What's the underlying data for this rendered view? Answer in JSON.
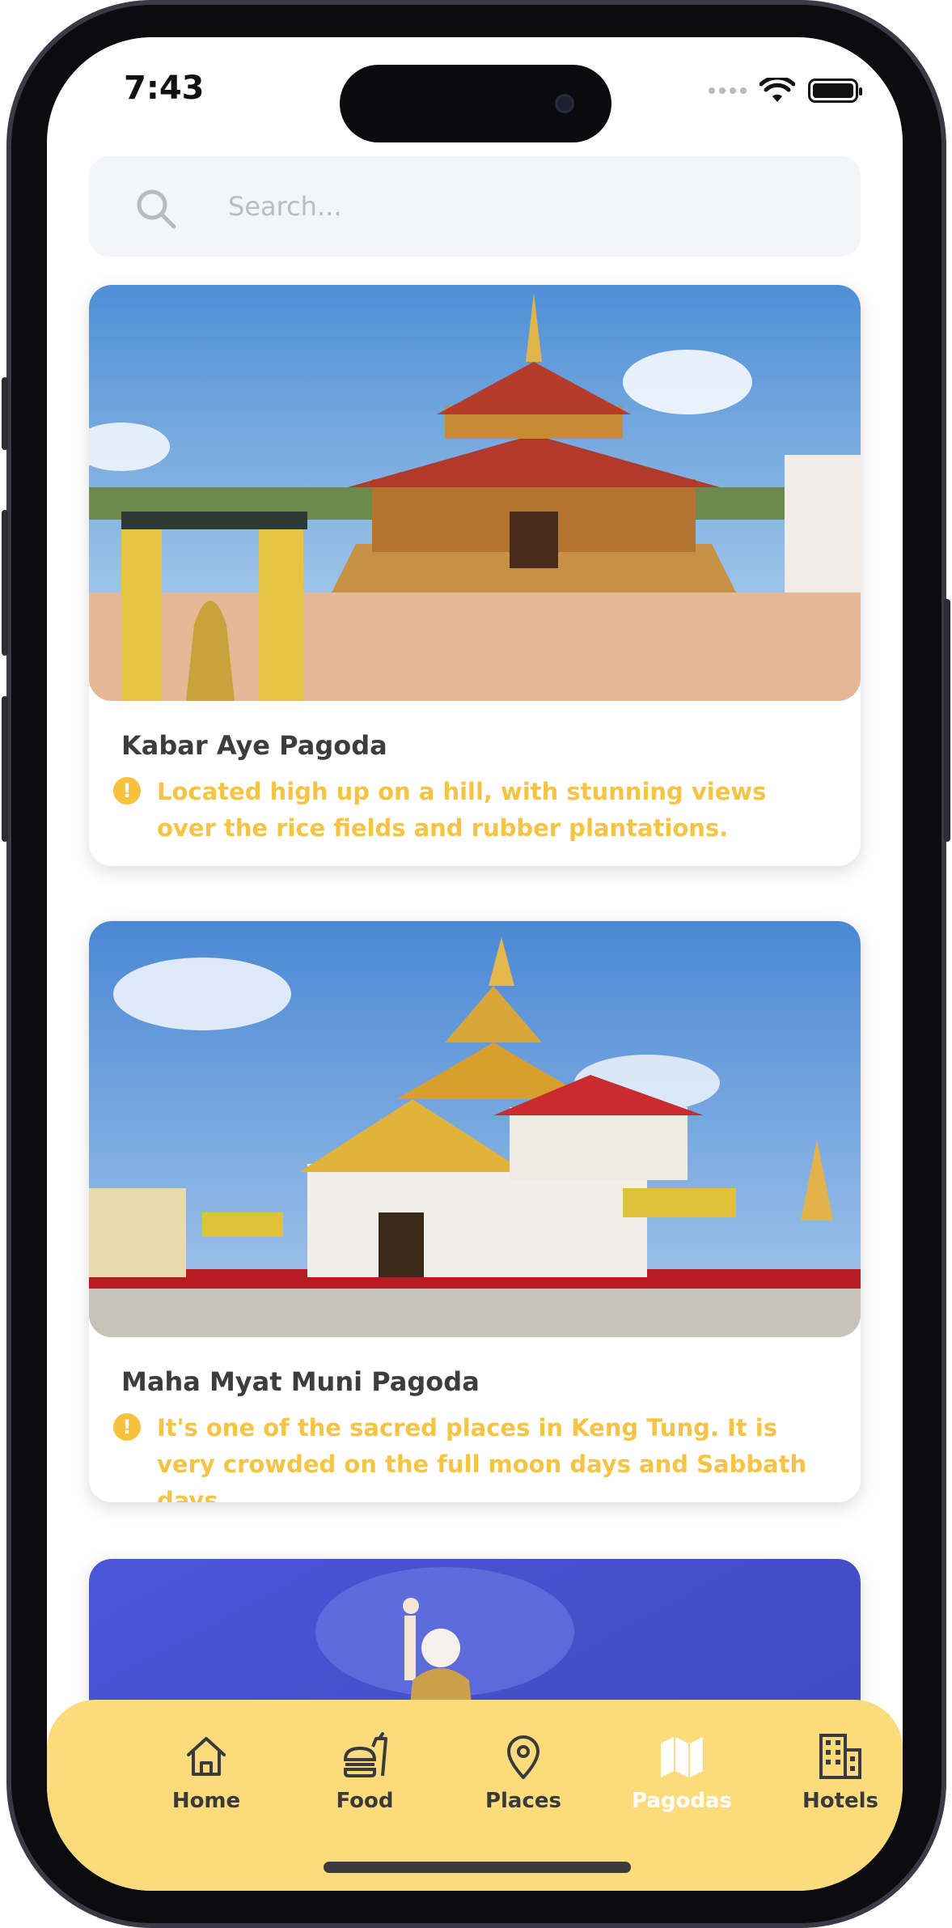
{
  "status": {
    "time": "7:43"
  },
  "search": {
    "placeholder": "Search..."
  },
  "cards": [
    {
      "title": "Kabar Aye Pagoda",
      "description": "Located high up on a hill, with stunning views over the rice fields and rubber plantations.",
      "image": "golden-red-pagoda-photo"
    },
    {
      "title": "Maha Myat Muni Pagoda",
      "description": "It's one of the sacred places in Keng Tung. It is very crowded on the full moon days and Sabbath days.",
      "image": "white-gold-temple-photo"
    },
    {
      "title": "",
      "description": "",
      "image": "standing-buddha-statue-photo"
    }
  ],
  "tabs": [
    {
      "label": "Home",
      "icon": "home-icon",
      "active": false
    },
    {
      "label": "Food",
      "icon": "burger-icon",
      "active": false
    },
    {
      "label": "Places",
      "icon": "map-pin-icon",
      "active": false
    },
    {
      "label": "Pagodas",
      "icon": "map-icon",
      "active": true
    },
    {
      "label": "Hotels",
      "icon": "building-icon",
      "active": false
    }
  ],
  "colors": {
    "accent_yellow": "#f5c444",
    "tabbar_bg": "#fcdb7c",
    "tab_inactive": "#3a3a3a",
    "tab_active": "#ffffff"
  }
}
